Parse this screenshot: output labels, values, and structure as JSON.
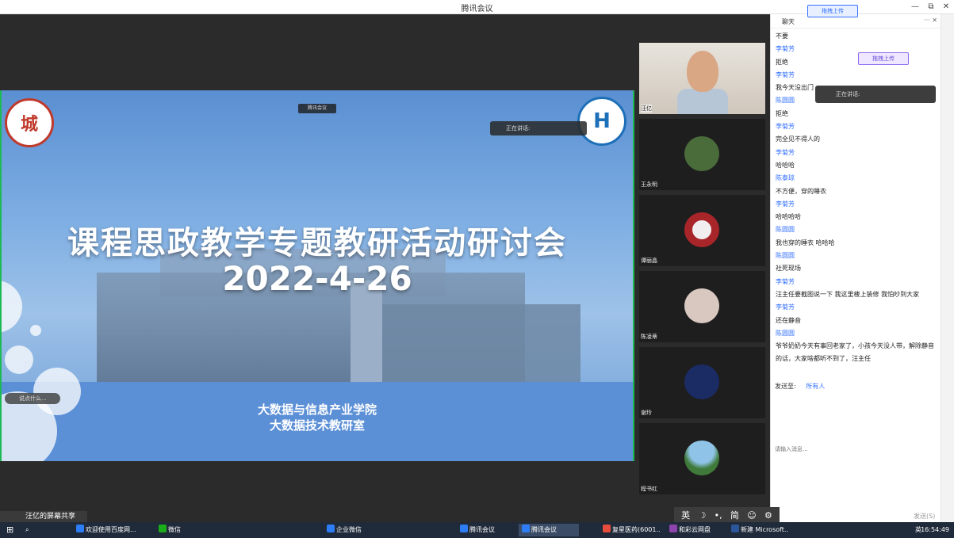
{
  "window": {
    "title": "腾讯会议",
    "minimize": "—",
    "restore": "⧉",
    "close": "✕"
  },
  "slide": {
    "title": "课程思政教学专题教研活动研讨会",
    "date": "2022-4-26",
    "college": "大数据与信息产业学院",
    "dept": "大数据技术教研室",
    "meeting_tag": "腾讯会议",
    "speaking": "正在讲话:",
    "say_something": "说点什么...",
    "logo_left_char": "城"
  },
  "share_label": "汪亿的屏幕共享",
  "participants": [
    {
      "name": "汪亿",
      "kind": "camera"
    },
    {
      "name": "王永明",
      "kind": "avatar",
      "color": "#4a6b3a"
    },
    {
      "name": "谭丽晶",
      "kind": "avatar",
      "color": "#a8252a"
    },
    {
      "name": "陈凌蒂",
      "kind": "avatar",
      "color": "#d9c8c0"
    },
    {
      "name": "谢玲",
      "kind": "avatar",
      "color": "#1b2b63"
    },
    {
      "name": "程书红",
      "kind": "avatar",
      "color": "#3f7a3a"
    }
  ],
  "chat": {
    "header": "聊天",
    "upload_label": "拖拽上传",
    "speaking_label": "正在讲话:",
    "messages": [
      {
        "text": "不要"
      },
      {
        "sender": "李菊芳",
        "text": "拒绝"
      },
      {
        "sender": "李菊芳",
        "text": "我今天没出门"
      },
      {
        "sender": "陈圆圆",
        "text": "拒绝"
      },
      {
        "sender": "李菊芳",
        "text": "完全见不得人的"
      },
      {
        "sender": "李菊芳",
        "text": "哈哈哈"
      },
      {
        "sender": "陈泰琼",
        "text": "不方便，穿的睡衣"
      },
      {
        "sender": "李菊芳",
        "text": "哈哈哈哈"
      },
      {
        "sender": "陈圆圆",
        "text": "我也穿的睡衣 哈哈哈"
      },
      {
        "sender": "陈圆圆",
        "text": "社死现场"
      },
      {
        "sender": "李菊芳",
        "text": "汪主任要截图说一下  我这里楼上装修  我怕吵到大家"
      },
      {
        "sender": "李菊芳",
        "text": "还在静音"
      },
      {
        "sender": "陈圆圆",
        "text": "爷爷奶奶今天有事回老家了，小孩今天没人带，解除静音的话，大家啥都听不到了，汪主任"
      }
    ],
    "send_to_label": "发送至:",
    "send_to_value": "所有人",
    "input_placeholder": "请输入消息...",
    "send_button": "发送(S)"
  },
  "ime": [
    "英",
    "☽",
    "•,",
    "简",
    "☺",
    "⚙"
  ],
  "taskbar": {
    "items": [
      {
        "label": "欢迎使用百度网...",
        "color": "#2d7df6"
      },
      {
        "label": "微信",
        "color": "#1aad19"
      },
      {
        "label": "企业微信",
        "color": "#2d7df6"
      },
      {
        "label": "腾讯会议",
        "color": "#2d7df6"
      },
      {
        "label": "腾讯会议",
        "color": "#2d7df6"
      },
      {
        "label": "复星医药(6001...",
        "color": "#e74c3c"
      },
      {
        "label": "和彩云网盘",
        "color": "#8e44ad"
      },
      {
        "label": "新建 Microsoft...",
        "color": "#2b579a"
      }
    ],
    "lang": "英",
    "time": "16:54:49"
  }
}
